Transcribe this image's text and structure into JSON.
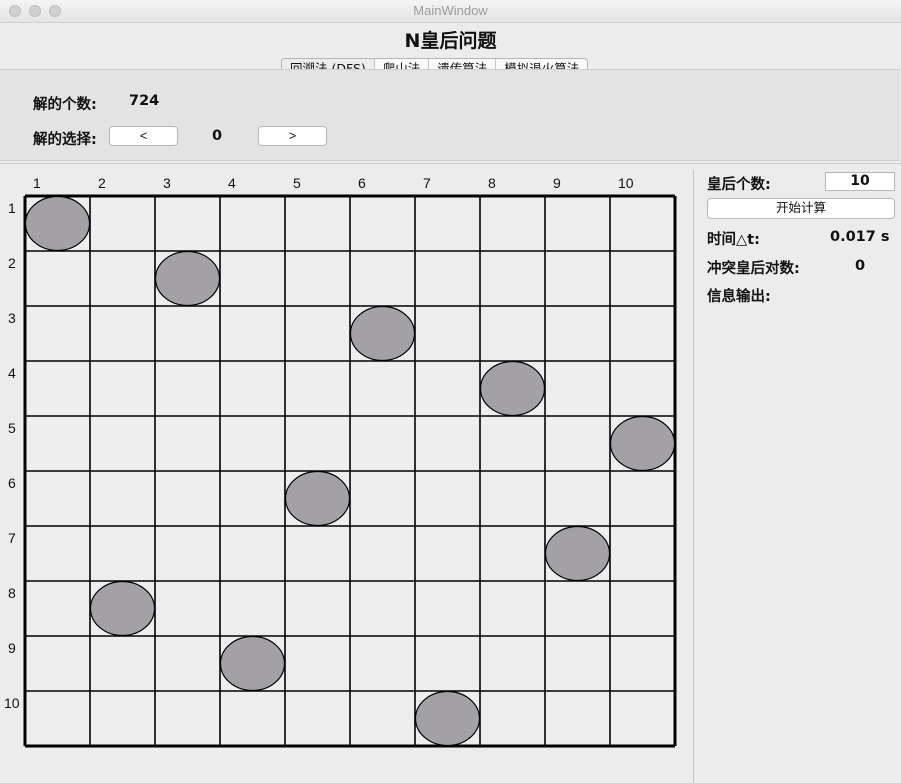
{
  "window": {
    "title": "MainWindow"
  },
  "app": {
    "title": "N皇后问题"
  },
  "tabs": [
    {
      "label": "回溯法 (DFS)"
    },
    {
      "label": "爬山法"
    },
    {
      "label": "遗传算法"
    },
    {
      "label": "模拟退火算法"
    }
  ],
  "solutions": {
    "count_label": "解的个数:",
    "count_value": "724",
    "select_label": "解的选择:",
    "prev_label": "<",
    "index_value": "0",
    "next_label": ">"
  },
  "board": {
    "size": 10,
    "columns": [
      "1",
      "2",
      "3",
      "4",
      "5",
      "6",
      "7",
      "8",
      "9",
      "10"
    ],
    "rows": [
      "1",
      "2",
      "3",
      "4",
      "5",
      "6",
      "7",
      "8",
      "9",
      "10"
    ],
    "queen_columns": [
      1,
      3,
      6,
      8,
      10,
      5,
      9,
      2,
      4,
      7
    ],
    "queen_color": "#a3a1a6",
    "cell_color": "#eeeeee",
    "line_color": "#000000"
  },
  "controls": {
    "queen_count_label": "皇后个数:",
    "queen_count_value": "10",
    "start_button": "开始计算",
    "time_label": "时间△t:",
    "time_value": "0.017 s",
    "conflict_label": "冲突皇后对数:",
    "conflict_value": "0",
    "info_label": "信息输出:"
  }
}
